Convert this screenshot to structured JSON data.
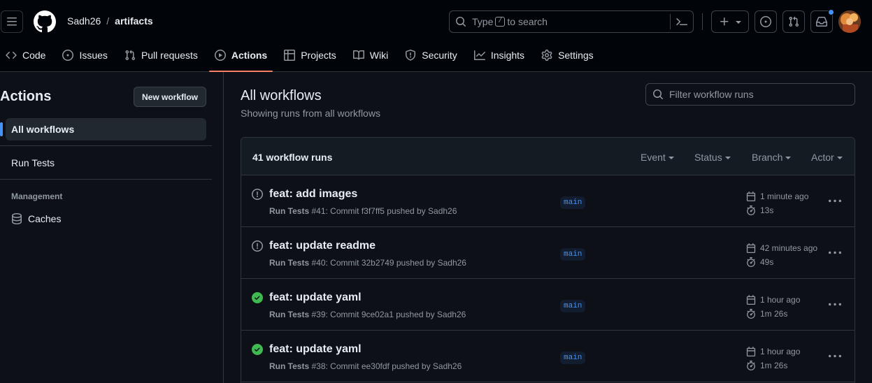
{
  "header": {
    "owner": "Sadh26",
    "separator": "/",
    "repo": "artifacts",
    "search_prefix": "Type",
    "search_key": "/",
    "search_suffix": "to search",
    "has_notification": true
  },
  "repo_nav": [
    {
      "label": "Code",
      "icon": "code-icon",
      "active": false
    },
    {
      "label": "Issues",
      "icon": "issue-opened-icon",
      "active": false
    },
    {
      "label": "Pull requests",
      "icon": "git-pull-request-icon",
      "active": false
    },
    {
      "label": "Actions",
      "icon": "play-icon",
      "active": true
    },
    {
      "label": "Projects",
      "icon": "table-icon",
      "active": false
    },
    {
      "label": "Wiki",
      "icon": "book-icon",
      "active": false
    },
    {
      "label": "Security",
      "icon": "shield-icon",
      "active": false
    },
    {
      "label": "Insights",
      "icon": "graph-icon",
      "active": false
    },
    {
      "label": "Settings",
      "icon": "gear-icon",
      "active": false
    }
  ],
  "sidebar": {
    "title": "Actions",
    "new_workflow_label": "New workflow",
    "all_workflows": "All workflows",
    "workflows": [
      "Run Tests"
    ],
    "management_label": "Management",
    "caches_label": "Caches"
  },
  "main": {
    "title": "All workflows",
    "subtitle": "Showing runs from all workflows",
    "filter_placeholder": "Filter workflow runs",
    "runs_count": "41 workflow runs",
    "filters": [
      "Event",
      "Status",
      "Branch",
      "Actor"
    ]
  },
  "runs": [
    {
      "title": "feat: add images",
      "status": "failure",
      "workflow": "Run Tests",
      "meta": "#41: Commit f3f7ff5 pushed by Sadh26",
      "branch": "main",
      "time": "1 minute ago",
      "duration": "13s"
    },
    {
      "title": "feat: update readme",
      "status": "failure",
      "workflow": "Run Tests",
      "meta": "#40: Commit 32b2749 pushed by Sadh26",
      "branch": "main",
      "time": "42 minutes ago",
      "duration": "49s"
    },
    {
      "title": "feat: update yaml",
      "status": "success",
      "workflow": "Run Tests",
      "meta": "#39: Commit 9ce02a1 pushed by Sadh26",
      "branch": "main",
      "time": "1 hour ago",
      "duration": "1m 26s"
    },
    {
      "title": "feat: update yaml",
      "status": "success",
      "workflow": "Run Tests",
      "meta": "#38: Commit ee30fdf pushed by Sadh26",
      "branch": "main",
      "time": "1 hour ago",
      "duration": "1m 26s"
    }
  ],
  "colors": {
    "background": "#0d1117",
    "header": "#010409",
    "border": "#30363d",
    "accent_blue": "#4493f8",
    "active_underline": "#f78166",
    "success": "#3fb950",
    "muted": "#9198a1"
  }
}
